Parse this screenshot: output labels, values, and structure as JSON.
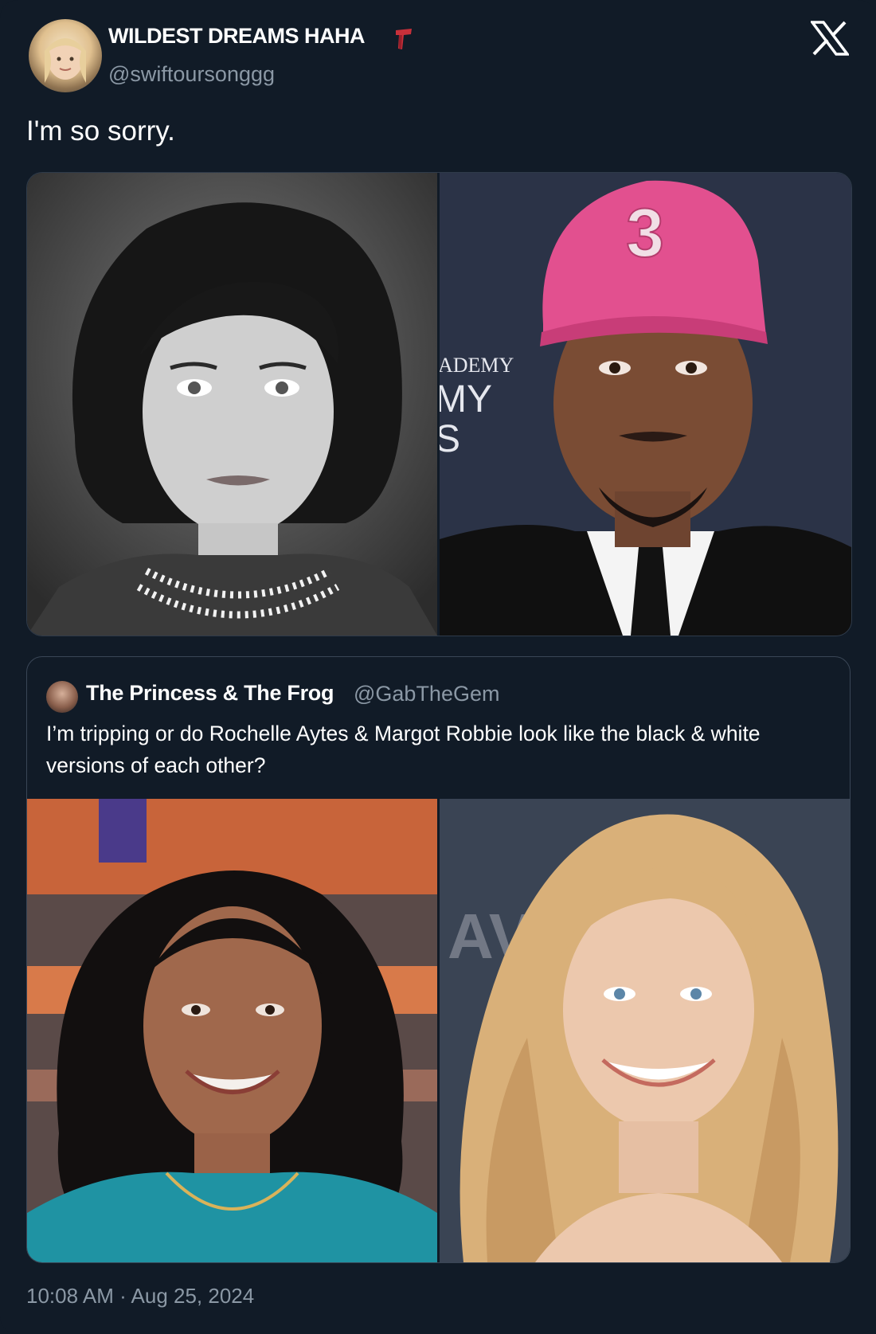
{
  "tweet": {
    "author_name": "WILDEST DREAMS HAHA",
    "author_handle": "@swiftoursonggg",
    "text": "I'm so sorry.",
    "timestamp": "10:08 AM · Aug 25, 2024",
    "badge_icon": "red-scarf-emoji-icon",
    "platform_icon": "x-logo-icon",
    "media": [
      {
        "name": "bw-portrait-woman-photo"
      },
      {
        "name": "man-pink-cap-photo",
        "cap_number": "3",
        "backdrop_text": [
          "ADEMY",
          "MY",
          "S"
        ]
      }
    ]
  },
  "quoted_tweet": {
    "author_name": "The Princess & The Frog",
    "author_handle": "@GabTheGem",
    "text": "I’m tripping or do Rochelle Aytes & Margot Robbie look like the black & white versions of each other?",
    "media": [
      {
        "name": "dark-hair-woman-photo"
      },
      {
        "name": "blonde-woman-photo",
        "backdrop_text": "AV"
      }
    ]
  },
  "colors": {
    "background": "#111b27",
    "text_primary": "#ffffff",
    "text_secondary": "#8b98a5",
    "border": "#3a4656",
    "cap_pink": "#e2508f"
  }
}
